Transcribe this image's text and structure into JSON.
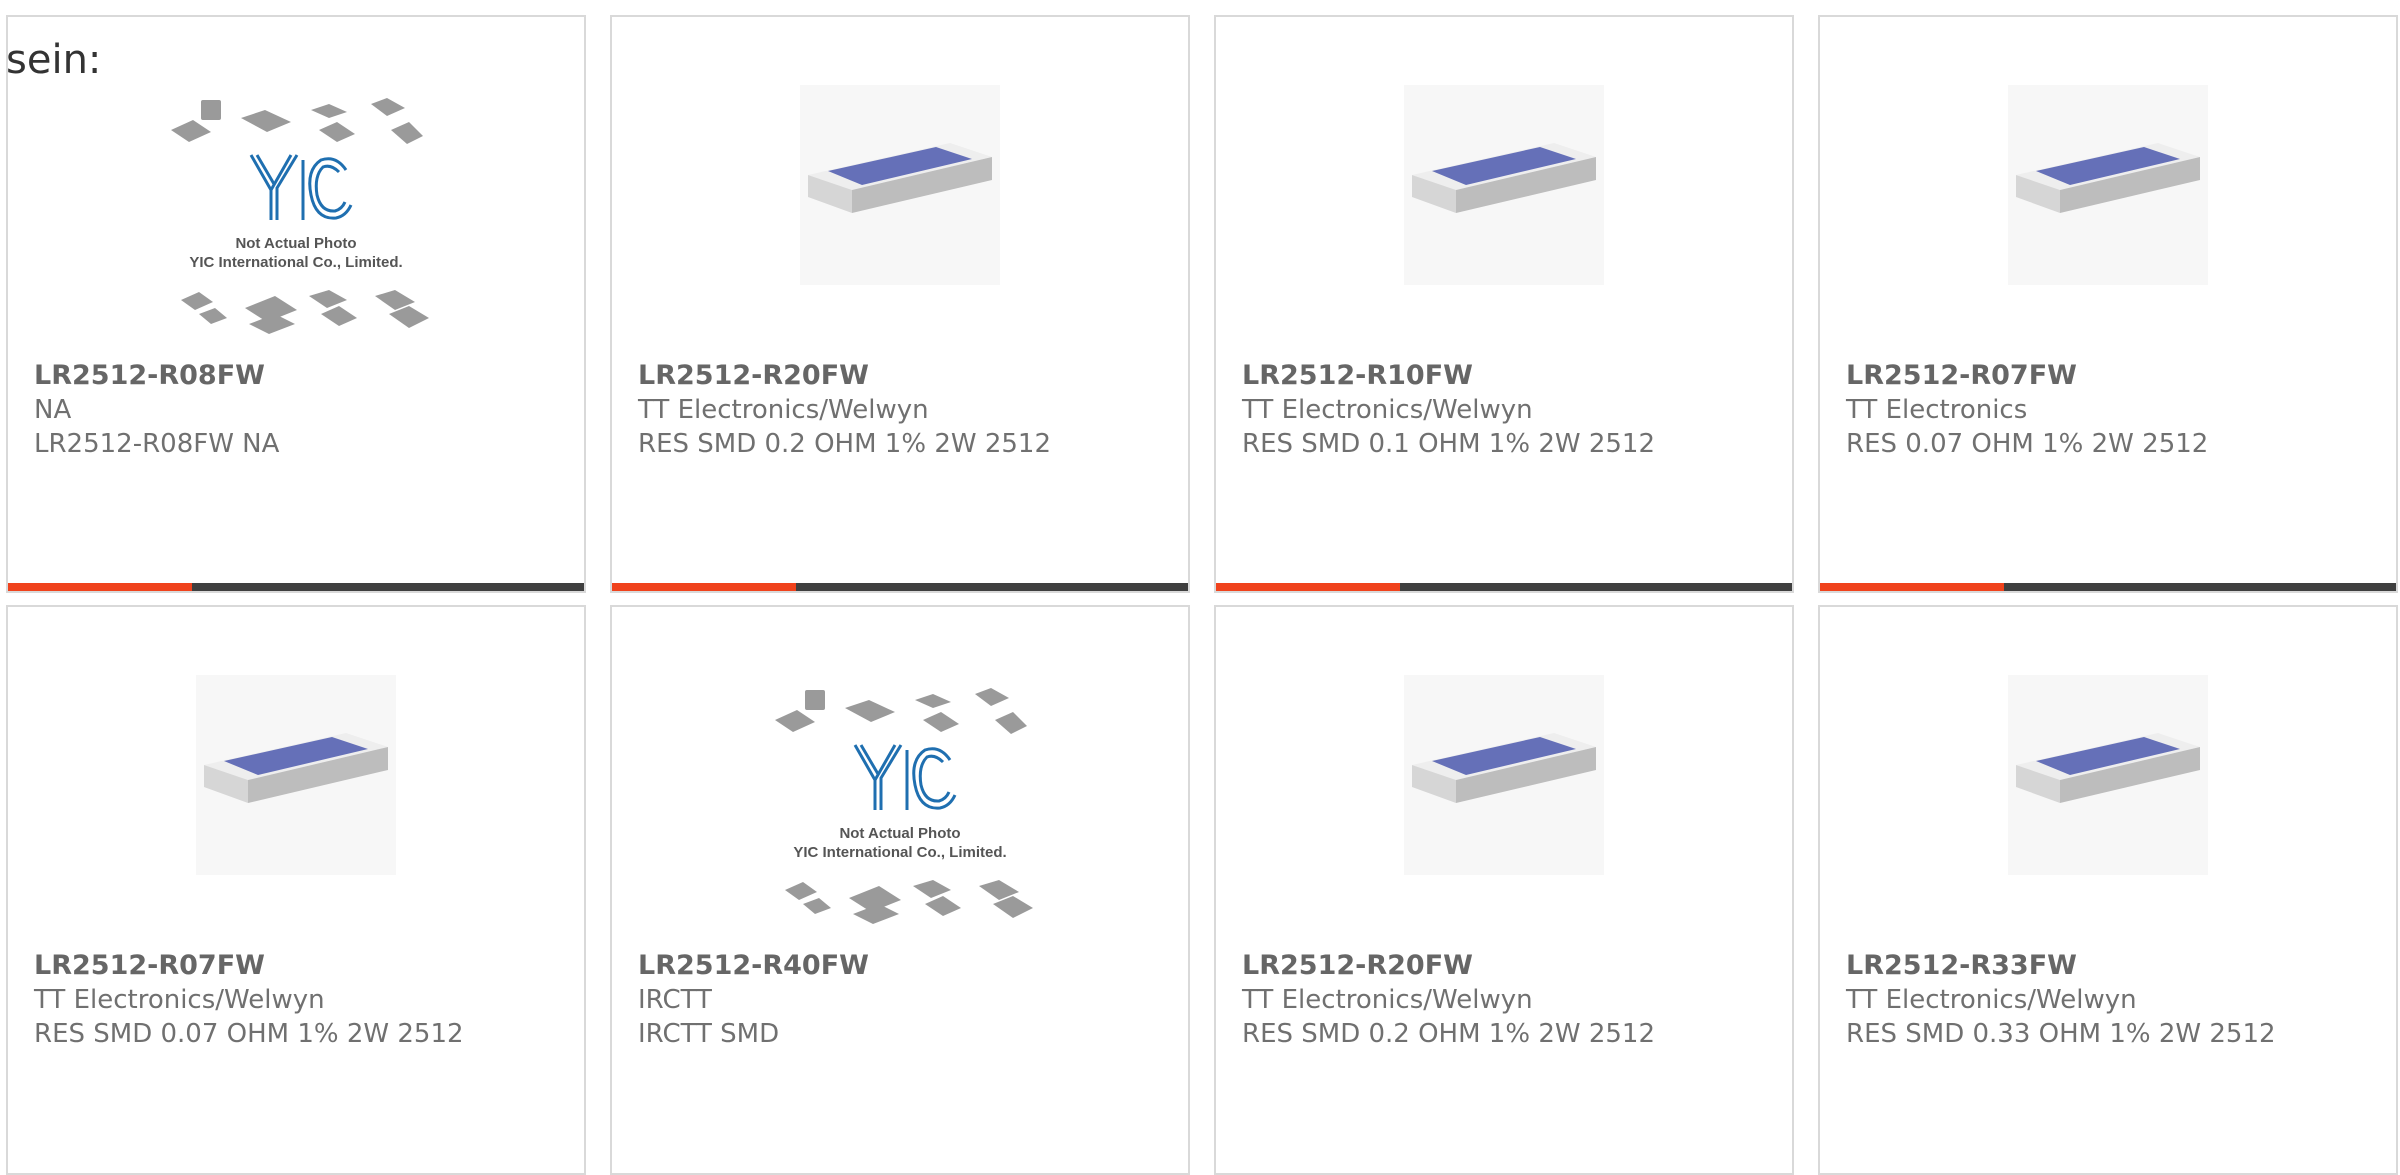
{
  "lead_text": "sein:",
  "colors": {
    "accent": "#f0421c",
    "bar": "#3f3f3f",
    "border": "#d9d9d9",
    "text": "#707070",
    "resistor_top": "#6570b8"
  },
  "products": [
    {
      "part": "LR2512-R08FW",
      "manufacturer": "NA",
      "description": "LR2512-R08FW NA",
      "image": "yic-placeholder",
      "placeholder_text": [
        "Not Actual Photo",
        "YIC International Co., Limited."
      ]
    },
    {
      "part": "LR2512-R20FW",
      "manufacturer": "TT Electronics/Welwyn",
      "description": "RES SMD 0.2 OHM 1% 2W 2512",
      "image": "smd-resistor-chip"
    },
    {
      "part": "LR2512-R10FW",
      "manufacturer": "TT Electronics/Welwyn",
      "description": "RES SMD 0.1 OHM 1% 2W 2512",
      "image": "smd-resistor-chip"
    },
    {
      "part": "LR2512-R07FW",
      "manufacturer": "TT Electronics",
      "description": "RES 0.07 OHM 1% 2W 2512",
      "image": "smd-resistor-chip"
    },
    {
      "part": "LR2512-R07FW",
      "manufacturer": "TT Electronics/Welwyn",
      "description": "RES SMD 0.07 OHM 1% 2W 2512",
      "image": "smd-resistor-chip"
    },
    {
      "part": "LR2512-R40FW",
      "manufacturer": "IRCTT",
      "description": "IRCTT SMD",
      "image": "yic-placeholder",
      "placeholder_text": [
        "Not Actual Photo",
        "YIC International Co., Limited."
      ]
    },
    {
      "part": "LR2512-R20FW",
      "manufacturer": "TT Electronics/Welwyn",
      "description": "RES SMD 0.2 OHM 1% 2W 2512",
      "image": "smd-resistor-chip"
    },
    {
      "part": "LR2512-R33FW",
      "manufacturer": "TT Electronics/Welwyn",
      "description": "RES SMD 0.33 OHM 1% 2W 2512",
      "image": "smd-resistor-chip"
    }
  ]
}
